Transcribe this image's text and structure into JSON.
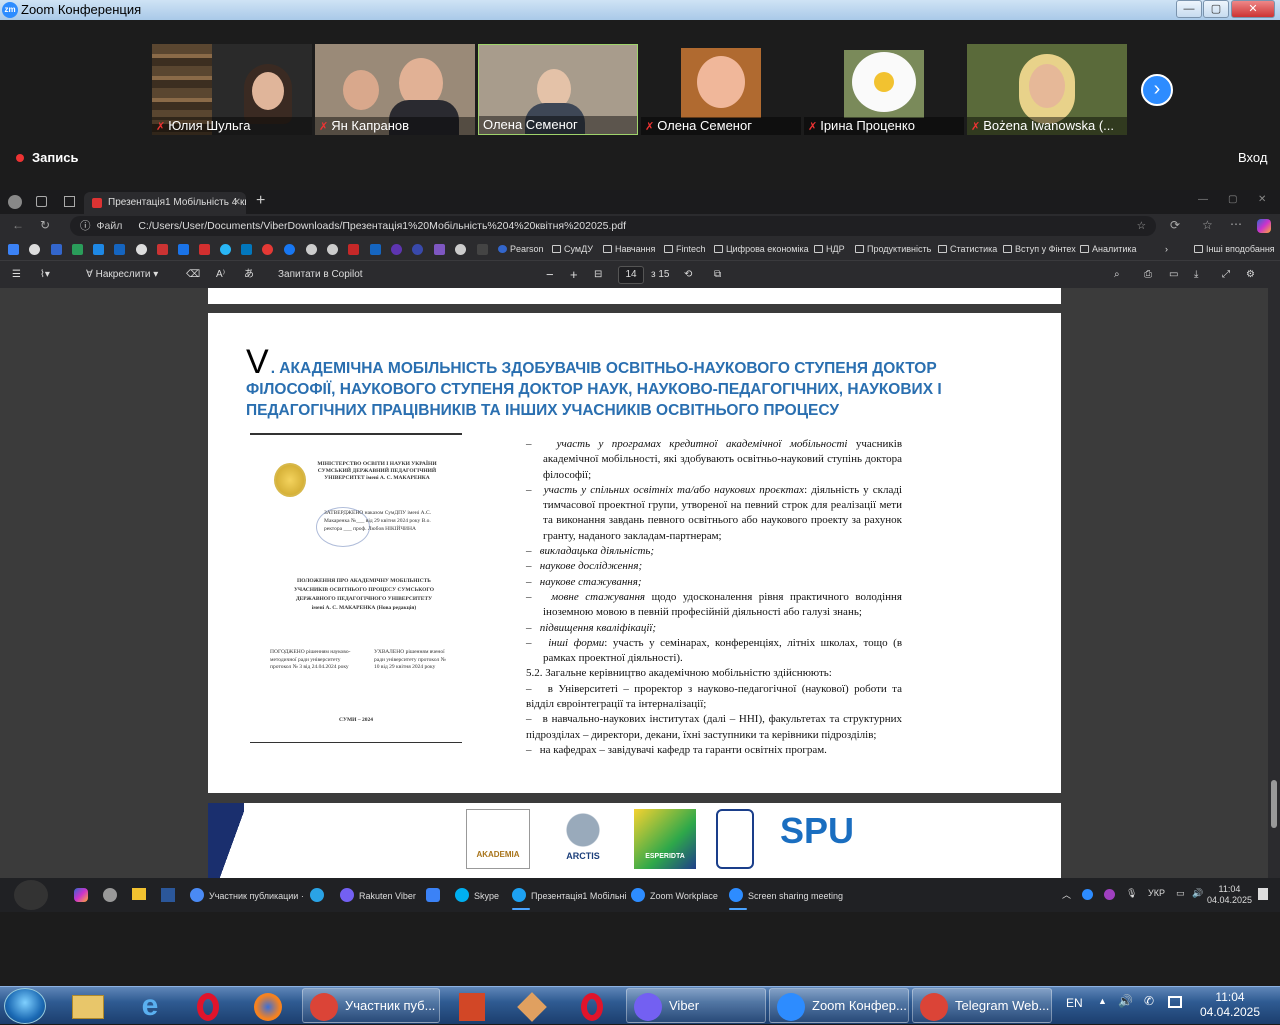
{
  "zoom_window": {
    "title": "Zoom Конференция",
    "logo_text": "zm",
    "minimize": "—",
    "maximize": "▢",
    "close": "✕"
  },
  "participants": [
    {
      "name": "Юлия Шульга",
      "muted": true,
      "bg": "#6b5a44"
    },
    {
      "name": "Ян Капранов",
      "muted": true,
      "bg": "#8a7a6a"
    },
    {
      "name": "Олена Семеног",
      "muted": false,
      "bg": "#a89c8c"
    },
    {
      "name": "Олена Семеног",
      "muted": true,
      "bg": "#1c1c1c"
    },
    {
      "name": "Ірина Проценко",
      "muted": true,
      "bg": "#1c1c1c"
    },
    {
      "name": "Bożena Iwanowska (...",
      "muted": true,
      "bg": "#4a5a3a"
    }
  ],
  "meeting": {
    "record_label": "Запись",
    "login_label": "Вход"
  },
  "browser": {
    "tab_title": "Презентація1 Мобільність 4 кві",
    "tab_close": "✕",
    "new_tab": "+",
    "file_label": "Файл",
    "url": "C:/Users/User/Documents/ViberDownloads/Презентація1%20Мобільність%204%20квітня%202025.pdf",
    "bookmarks": [
      {
        "label": "Pearson"
      },
      {
        "label": "СумДУ"
      },
      {
        "label": "Навчання"
      },
      {
        "label": "Fintech"
      },
      {
        "label": "Цифрова економіка"
      },
      {
        "label": "НДР"
      },
      {
        "label": "Продуктивність"
      },
      {
        "label": "Статистика"
      },
      {
        "label": "Вступ у Фінтех"
      },
      {
        "label": "Аналитика"
      }
    ],
    "other_bookmarks": "Інші вподобання",
    "pdf_toolbar": {
      "draw_label": "Накреслити",
      "copilot_label": "Запитати в Copilot",
      "zoom_out": "−",
      "zoom_in": "+",
      "page_current": "14",
      "page_total": "з 15"
    }
  },
  "slide": {
    "roman": "V",
    "title": ". АКАДЕМІЧНА МОБІЛЬНІСТЬ ЗДОБУВАЧІВ ОСВІТНЬО-НАУКОВОГО СТУПЕНЯ ДОКТОР ФІЛОСОФІЇ, НАУКОВОГО СТУПЕНЯ ДОКТОР НАУК, НАУКОВО-ПЕДАГОГІЧНИХ, НАУКОВИХ І ПЕДАГОГІЧНИХ ПРАЦІВНИКІВ ТА ІНШИХ УЧАСНИКІВ ОСВІТНЬОГО ПРОЦЕСУ",
    "doc": {
      "ministry": "МІНІСТЕРСТВО ОСВІТИ І НАУКИ УКРАЇНИ СУМСЬКИЙ ДЕРЖАВНИЙ ПЕДАГОГІЧНИЙ УНІВЕРСИТЕТ імені А. С. МАКАРЕНКА",
      "approved": "ЗАТВЕРДЖЕНО наказом СумДПУ імені А.С. Макаренка №___ від 29 квітня 2024 року В.о. ректора ___ проф. Любов НІКІЙЧИНА",
      "heading": "ПОЛОЖЕННЯ ПРО АКАДЕМІЧНУ МОБІЛЬНІСТЬ УЧАСНИКІВ ОСВІТНЬОГО ПРОЦЕСУ СУМСЬКОГО ДЕРЖАВНОГО ПЕДАГОГІЧНОГО УНІВЕРСИТЕТУ імені А. С. МАКАРЕНКА (Нова редакція)",
      "agreed": "ПОГОДЖЕНО рішенням науково-методичної ради університету протокол № 3 від 24.04.2024 року",
      "adopted": "УХВАЛЕНО рішенням вченої ради університету протокол № 10 від 29 квітня 2024 року",
      "city": "СУМИ – 2024"
    },
    "items": [
      {
        "italic": "участь у програмах кредитної академічної мобільності",
        "rest": " учасників академічної мобільності, які здобувають освітньо-науковий ступінь доктора філософії;"
      },
      {
        "italic": "участь у спільних освітніх та/або наукових проєктах",
        "rest": ": діяльність у складі тимчасової проектної групи, утвореної на певний строк для реалізації мети та виконання завдань певного освітнього або наукового проекту за рахунок гранту, наданого закладам-партнерам;"
      },
      {
        "italic": "викладацька діяльність;",
        "rest": ""
      },
      {
        "italic": "наукове дослідження;",
        "rest": ""
      },
      {
        "italic": "наукове стажування;",
        "rest": ""
      },
      {
        "italic": "мовне стажування",
        "rest": " щодо удосконалення рівня практичного володіння іноземною мовою в певній професійній діяльності або галузі знань;"
      },
      {
        "italic": "підвищення кваліфікації;",
        "rest": ""
      },
      {
        "italic": "інші форми",
        "rest": ": участь у семінарах, конференціях, літніх школах, тощо (в рамках проектної діяльності)."
      }
    ],
    "section": "5.2. Загальне керівництво академічною мобільністю здійснюють:",
    "sub_items": [
      "в Університеті – проректор з науково-педагогічної (наукової) роботи та відділ євроінтеграції та інтерналізації;",
      "в навчально-наукових інститутах (далі – ННІ), факультетах та структурних підрозділах – директори, декани, їхні заступники та керівники підрозділів;",
      "на кафедрах – завідувачі кафедр та гаранти освітніх програм."
    ]
  },
  "next_page_logos": [
    "AKADEMIA",
    "ARCTIS",
    "ESPERIDTA",
    "SPU"
  ],
  "inner_taskbar": {
    "tasks": [
      {
        "label": "Участник публикации ·",
        "color": "#4a8af4"
      },
      {
        "label": "",
        "color": "#2aa3e6"
      },
      {
        "label": "Rakuten Viber",
        "color": "#7360f2"
      },
      {
        "label": "",
        "color": "#3b82f6"
      },
      {
        "label": "Skype",
        "color": "#00aff0"
      },
      {
        "label": "Презентація1 Мобільні",
        "color": "#1da1f2"
      },
      {
        "label": "Zoom Workplace",
        "color": "#2d8cff"
      },
      {
        "label": "Screen sharing meeting",
        "color": "#2d8cff"
      }
    ],
    "lang": "УКР",
    "time": "11:04",
    "date": "04.04.2025"
  },
  "win_taskbar": {
    "tasks": [
      {
        "label": "Участник пуб...",
        "color": "#db4437"
      },
      {
        "label": "Viber",
        "color": "#7360f2"
      },
      {
        "label": "Zoom Конфер...",
        "color": "#2d8cff"
      },
      {
        "label": "Telegram Web...",
        "color": "#db4437"
      }
    ],
    "lang": "EN",
    "time": "11:04",
    "date": "04.04.2025"
  }
}
